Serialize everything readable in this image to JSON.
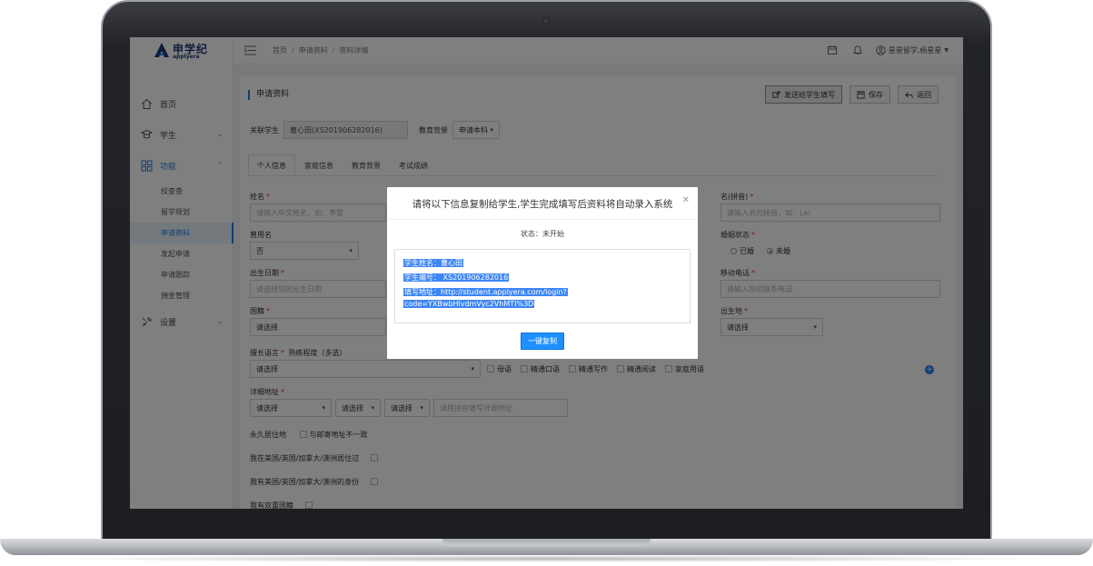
{
  "brand": {
    "name": "申学纪",
    "sub": "applyera"
  },
  "sidebar": {
    "items": [
      {
        "label": "首页",
        "icon": "home-icon"
      },
      {
        "label": "学生",
        "icon": "student-icon"
      },
      {
        "label": "功能",
        "icon": "grid-icon"
      },
      {
        "label": "设置",
        "icon": "wrench-icon"
      }
    ],
    "sub_items": [
      "校查查",
      "留学规划",
      "申请资料",
      "发起申请",
      "申请跟踪",
      "佣金管理"
    ],
    "active_sub": "申请资料"
  },
  "topbar": {
    "breadcrumb": [
      "首页",
      "申请资料",
      "资料详情"
    ],
    "user": "星星留学,杨星星"
  },
  "page": {
    "title": "申请资料",
    "buttons": {
      "send": "发送给学生填写",
      "save": "保存",
      "back": "返回"
    },
    "linked_student_label": "关联学生",
    "linked_student_value": "曹心田(XS201906282016)",
    "edu_bg_label": "教育背景",
    "edu_bg_value": "申请本科",
    "tabs": [
      "个人信息",
      "家庭信息",
      "教育背景",
      "考试成绩"
    ]
  },
  "form": {
    "name_label": "姓名",
    "name_placeholder": "请输入中文姓名，如：李雷",
    "pinyin_label": "名(拼音)",
    "pinyin_placeholder": "请输入名的拼音，如：Lei",
    "former_name_label": "曾用名",
    "former_name_value": "否",
    "marital_label": "婚姻状态",
    "marital_options": [
      "已婚",
      "未婚"
    ],
    "birth_label": "出生日期",
    "birth_placeholder": "请选择您的出生日期",
    "mobile_label": "移动电话",
    "mobile_placeholder": "请输入您的联系电话",
    "nationality_label": "国籍",
    "select_placeholder": "请选择",
    "birthplace_label": "出生地",
    "language_label": "擅长语言",
    "proficiency_label": "熟练程度（多选）",
    "proficiency_options": [
      "母语",
      "精通口语",
      "精通写作",
      "精通阅读",
      "家庭用语"
    ],
    "address_label": "详细地址",
    "address_placeholder": "请用拼音填写详细地址",
    "permanent_label": "永久居住地",
    "permanent_option": "与邮寄地址不一致",
    "lived_abroad_label": "我在美国/英国/加拿大/澳洲居住过",
    "identity_label": "我有美国/英国/加拿大/澳洲的身份",
    "dual_label": "我有双重国籍"
  },
  "modal": {
    "title": "请将以下信息复制给学生,学生完成填写后资料将自动录入系统",
    "status": "状态：未开始",
    "lines": [
      "学生姓名：曹心田",
      "学生编号： XS201906282016",
      "填写地址：http://student.applyera.com/login?",
      "code=YXBwbHlvdmVyc2VhMTI%3D"
    ],
    "copy_button": "一键复制"
  }
}
